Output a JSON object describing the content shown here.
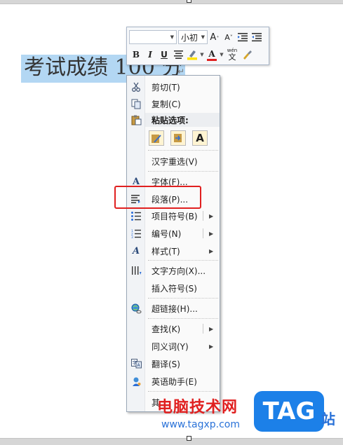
{
  "document": {
    "text": "考试成绩 100 分",
    "paragraph_mark": "↵"
  },
  "mini_toolbar": {
    "font_name": "",
    "font_size": "小初",
    "grow_font": "A",
    "shrink_font": "A",
    "bold": "B",
    "italic": "I",
    "underline": "U",
    "font_color_letter": "A",
    "phonetic_guide": "wén",
    "phonetic_char": "文"
  },
  "menu": {
    "items": [
      {
        "label": "剪切(T)",
        "icon": "scissors-icon"
      },
      {
        "label": "复制(C)",
        "icon": "copy-icon"
      },
      {
        "label": "粘贴选项:",
        "icon": "paste-icon"
      },
      {
        "label": "汉字重选(V)"
      },
      {
        "label": "字体(F)...",
        "icon": "font-icon"
      },
      {
        "label": "段落(P)...",
        "icon": "paragraph-icon"
      },
      {
        "label": "项目符号(B)",
        "icon": "bullets-icon"
      },
      {
        "label": "编号(N)",
        "icon": "numbering-icon"
      },
      {
        "label": "样式(T)",
        "icon": "styles-icon"
      },
      {
        "label": "文字方向(X)...",
        "icon": "text-direction-icon"
      },
      {
        "label": "插入符号(S)"
      },
      {
        "label": "超链接(H)...",
        "icon": "hyperlink-icon"
      },
      {
        "label": "查找(K)"
      },
      {
        "label": "同义词(Y)"
      },
      {
        "label": "翻译(S)",
        "icon": "translate-icon"
      },
      {
        "label": "英语助手(E)",
        "icon": "english-assistant-icon"
      },
      {
        "label": "其"
      }
    ],
    "paste_options": [
      "keep-source-formatting",
      "merge-formatting",
      "A"
    ]
  },
  "watermark": {
    "site_name": "电脑技术网",
    "url": "www.tagxp.com",
    "badge": "TAG",
    "suffix": "站"
  }
}
